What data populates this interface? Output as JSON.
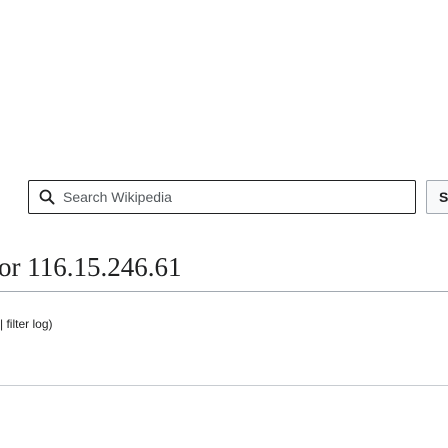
{
  "header": {
    "search": {
      "placeholder": "Search Wikipedia",
      "value": "",
      "button_label": "S",
      "icon": "search-icon"
    }
  },
  "main": {
    "title": "or 116.15.246.61",
    "subtitle_separator": "|",
    "subtitle_link": "filter log",
    "subtitle_link_open": " ",
    "subtitle_close": ")"
  },
  "colors": {
    "text": "#202122",
    "border": "#a2a9b1",
    "placeholder": "#54595d"
  }
}
